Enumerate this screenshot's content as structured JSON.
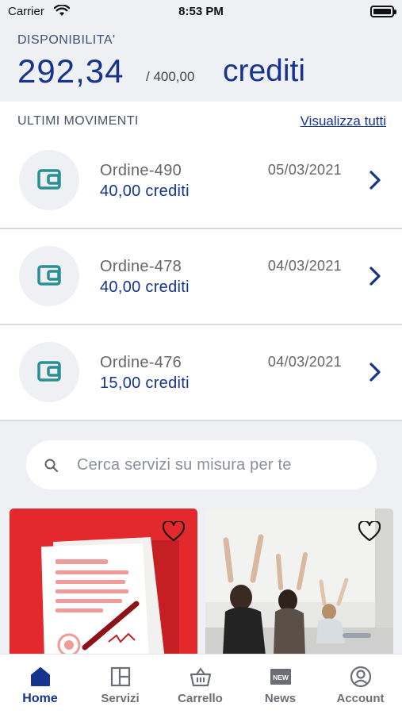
{
  "status_bar": {
    "carrier": "Carrier",
    "time": "8:53 PM"
  },
  "balance": {
    "label": "DISPONIBILITA'",
    "amount": "292,34",
    "total": "/ 400,00",
    "unit": "crediti"
  },
  "movements": {
    "title": "ULTIMI MOVIMENTI",
    "view_all": "Visualizza tutti",
    "items": [
      {
        "name": "Ordine-490",
        "amount": "40,00 crediti",
        "date": "05/03/2021",
        "icon": "wallet-icon"
      },
      {
        "name": "Ordine-478",
        "amount": "40,00 crediti",
        "date": "04/03/2021",
        "icon": "wallet-icon"
      },
      {
        "name": "Ordine-476",
        "amount": "15,00 crediti",
        "date": "04/03/2021",
        "icon": "wallet-icon"
      }
    ]
  },
  "search": {
    "placeholder": "Cerca servizi su misura per te"
  },
  "tabs": [
    {
      "label": "Home",
      "icon": "home-icon",
      "active": true
    },
    {
      "label": "Servizi",
      "icon": "grid-icon",
      "active": false
    },
    {
      "label": "Carrello",
      "icon": "basket-icon",
      "active": false
    },
    {
      "label": "News",
      "icon": "news-icon",
      "active": false
    },
    {
      "label": "Account",
      "icon": "account-icon",
      "active": false
    }
  ],
  "colors": {
    "accent": "#15338f",
    "teal": "#2a8f94",
    "promo_red": "#e4292d",
    "background": "#eef0f4"
  }
}
